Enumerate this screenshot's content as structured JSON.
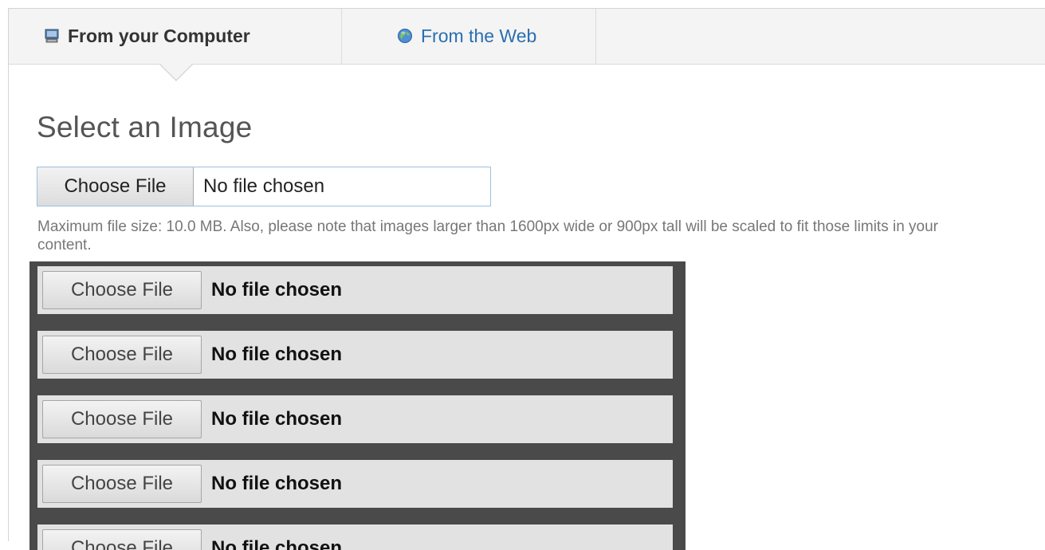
{
  "tabs": {
    "computer": {
      "label": "From your Computer",
      "icon": "computer-icon"
    },
    "web": {
      "label": "From the Web",
      "icon": "globe-icon"
    }
  },
  "heading": "Select an Image",
  "primary_input": {
    "button_label": "Choose File",
    "status": "No file chosen"
  },
  "help_text": "Maximum file size: 10.0 MB. Also, please note that images larger than 1600px wide or 900px tall will be scaled to fit those limits in your content.",
  "file_rows": [
    {
      "button_label": "Choose File",
      "status": "No file chosen"
    },
    {
      "button_label": "Choose File",
      "status": "No file chosen"
    },
    {
      "button_label": "Choose File",
      "status": "No file chosen"
    },
    {
      "button_label": "Choose File",
      "status": "No file chosen"
    },
    {
      "button_label": "Choose File",
      "status": "No file chosen"
    }
  ],
  "colors": {
    "active_tab_text": "#333333",
    "link_tab_text": "#2a6fb0",
    "dark_box": "#4a4a4a",
    "input_focus_border": "#9dbfe0"
  }
}
